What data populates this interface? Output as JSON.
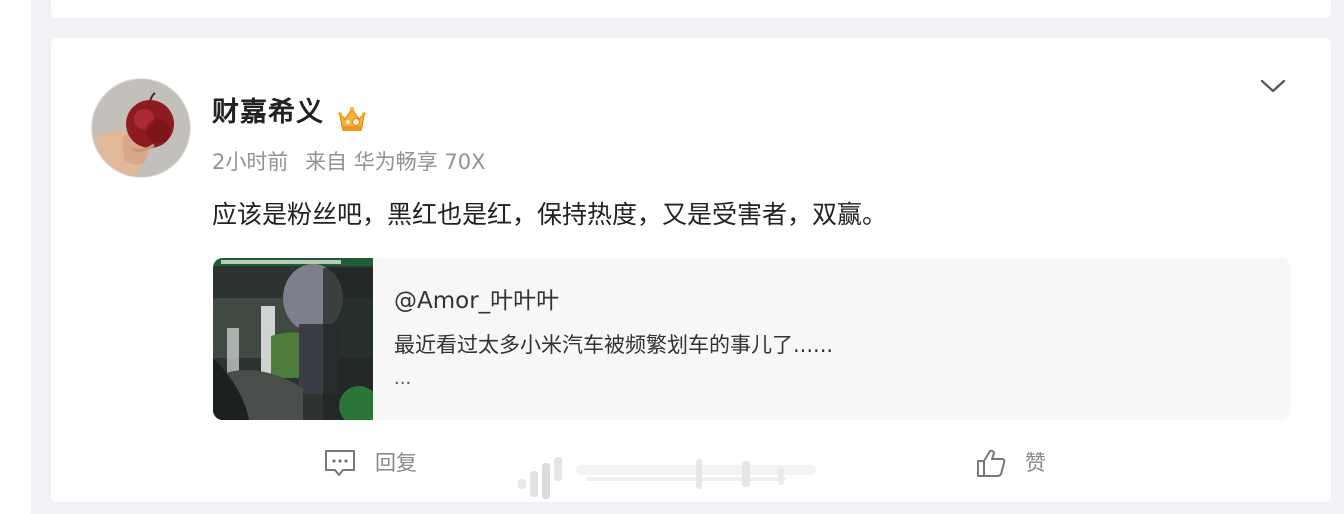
{
  "post": {
    "username": "财嘉希义",
    "time": "2小时前",
    "source": "来自 华为畅享 70X",
    "text": "应该是粉丝吧，黑红也是红，保持热度，又是受害者，双赢。"
  },
  "repost": {
    "user": "@Amor_叶叶叶",
    "text": "最近看过太多小米汽车被频繁划车的事儿了......",
    "more": "..."
  },
  "actions": {
    "reply_label": "回复",
    "like_label": "赞"
  },
  "icons": {
    "avatar": "avatar-apple-in-hand",
    "badge": "crown-icon",
    "menu": "chevron-down-icon",
    "reply": "comment-icon",
    "like": "thumbs-up-icon"
  },
  "colors": {
    "page_background": "#f1f2f5",
    "card_background": "#ffffff",
    "repost_background": "#f7f7f7",
    "meta_text": "#939393"
  }
}
